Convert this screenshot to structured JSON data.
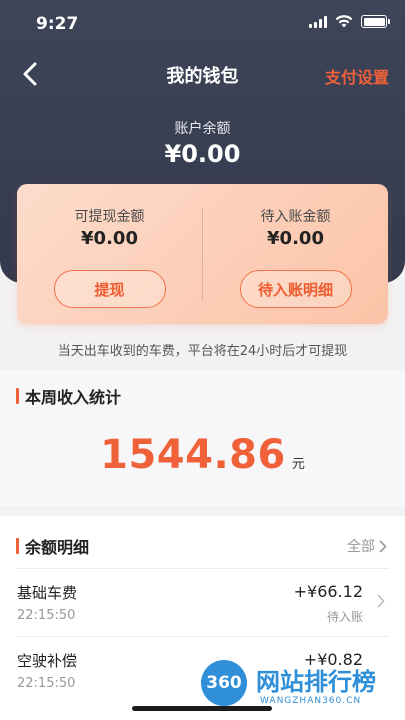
{
  "status_bar": {
    "time": "9:27"
  },
  "nav": {
    "title": "我的钱包",
    "settings_label": "支付设置"
  },
  "balance": {
    "label": "账户余额",
    "value": "¥0.00"
  },
  "summary": {
    "withdrawable_label": "可提现金额",
    "withdrawable_value": "¥0.00",
    "withdraw_button": "提现",
    "pending_label": "待入账金额",
    "pending_value": "¥0.00",
    "pending_button": "待入账明细"
  },
  "notice": "当天出车收到的车费，平台将在24小时后才可提现",
  "weekly": {
    "title": "本周收入统计",
    "amount": "1544.86",
    "unit": "元"
  },
  "details": {
    "title": "余额明细",
    "view_all": "全部",
    "rows": [
      {
        "name": "基础车费",
        "time": "22:15:50",
        "amount": "+¥66.12",
        "status": "待入账"
      },
      {
        "name": "空驶补偿",
        "time": "22:15:50",
        "amount": "+¥0.82",
        "status": ""
      }
    ]
  },
  "watermark": {
    "badge": "360",
    "text": "网站排行榜",
    "sub": "WANGZHAN360.CN"
  },
  "colors": {
    "accent": "#f0613a",
    "header_bg": "#3b4154",
    "card_bg": "#fcd3bf"
  },
  "icons": {
    "back": "chevron-left-icon",
    "view_all": "chevron-right-icon",
    "row": "chevron-right-icon"
  }
}
